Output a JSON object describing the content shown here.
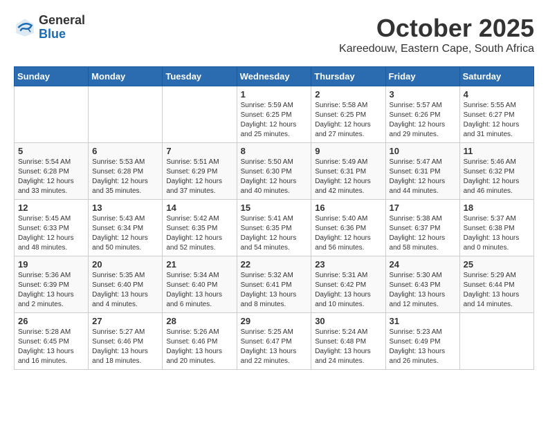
{
  "header": {
    "logo_general": "General",
    "logo_blue": "Blue",
    "title": "October 2025",
    "location": "Kareedouw, Eastern Cape, South Africa"
  },
  "days_of_week": [
    "Sunday",
    "Monday",
    "Tuesday",
    "Wednesday",
    "Thursday",
    "Friday",
    "Saturday"
  ],
  "weeks": [
    [
      {
        "day": "",
        "info": ""
      },
      {
        "day": "",
        "info": ""
      },
      {
        "day": "",
        "info": ""
      },
      {
        "day": "1",
        "info": "Sunrise: 5:59 AM\nSunset: 6:25 PM\nDaylight: 12 hours\nand 25 minutes."
      },
      {
        "day": "2",
        "info": "Sunrise: 5:58 AM\nSunset: 6:25 PM\nDaylight: 12 hours\nand 27 minutes."
      },
      {
        "day": "3",
        "info": "Sunrise: 5:57 AM\nSunset: 6:26 PM\nDaylight: 12 hours\nand 29 minutes."
      },
      {
        "day": "4",
        "info": "Sunrise: 5:55 AM\nSunset: 6:27 PM\nDaylight: 12 hours\nand 31 minutes."
      }
    ],
    [
      {
        "day": "5",
        "info": "Sunrise: 5:54 AM\nSunset: 6:28 PM\nDaylight: 12 hours\nand 33 minutes."
      },
      {
        "day": "6",
        "info": "Sunrise: 5:53 AM\nSunset: 6:28 PM\nDaylight: 12 hours\nand 35 minutes."
      },
      {
        "day": "7",
        "info": "Sunrise: 5:51 AM\nSunset: 6:29 PM\nDaylight: 12 hours\nand 37 minutes."
      },
      {
        "day": "8",
        "info": "Sunrise: 5:50 AM\nSunset: 6:30 PM\nDaylight: 12 hours\nand 40 minutes."
      },
      {
        "day": "9",
        "info": "Sunrise: 5:49 AM\nSunset: 6:31 PM\nDaylight: 12 hours\nand 42 minutes."
      },
      {
        "day": "10",
        "info": "Sunrise: 5:47 AM\nSunset: 6:31 PM\nDaylight: 12 hours\nand 44 minutes."
      },
      {
        "day": "11",
        "info": "Sunrise: 5:46 AM\nSunset: 6:32 PM\nDaylight: 12 hours\nand 46 minutes."
      }
    ],
    [
      {
        "day": "12",
        "info": "Sunrise: 5:45 AM\nSunset: 6:33 PM\nDaylight: 12 hours\nand 48 minutes."
      },
      {
        "day": "13",
        "info": "Sunrise: 5:43 AM\nSunset: 6:34 PM\nDaylight: 12 hours\nand 50 minutes."
      },
      {
        "day": "14",
        "info": "Sunrise: 5:42 AM\nSunset: 6:35 PM\nDaylight: 12 hours\nand 52 minutes."
      },
      {
        "day": "15",
        "info": "Sunrise: 5:41 AM\nSunset: 6:35 PM\nDaylight: 12 hours\nand 54 minutes."
      },
      {
        "day": "16",
        "info": "Sunrise: 5:40 AM\nSunset: 6:36 PM\nDaylight: 12 hours\nand 56 minutes."
      },
      {
        "day": "17",
        "info": "Sunrise: 5:38 AM\nSunset: 6:37 PM\nDaylight: 12 hours\nand 58 minutes."
      },
      {
        "day": "18",
        "info": "Sunrise: 5:37 AM\nSunset: 6:38 PM\nDaylight: 13 hours\nand 0 minutes."
      }
    ],
    [
      {
        "day": "19",
        "info": "Sunrise: 5:36 AM\nSunset: 6:39 PM\nDaylight: 13 hours\nand 2 minutes."
      },
      {
        "day": "20",
        "info": "Sunrise: 5:35 AM\nSunset: 6:40 PM\nDaylight: 13 hours\nand 4 minutes."
      },
      {
        "day": "21",
        "info": "Sunrise: 5:34 AM\nSunset: 6:40 PM\nDaylight: 13 hours\nand 6 minutes."
      },
      {
        "day": "22",
        "info": "Sunrise: 5:32 AM\nSunset: 6:41 PM\nDaylight: 13 hours\nand 8 minutes."
      },
      {
        "day": "23",
        "info": "Sunrise: 5:31 AM\nSunset: 6:42 PM\nDaylight: 13 hours\nand 10 minutes."
      },
      {
        "day": "24",
        "info": "Sunrise: 5:30 AM\nSunset: 6:43 PM\nDaylight: 13 hours\nand 12 minutes."
      },
      {
        "day": "25",
        "info": "Sunrise: 5:29 AM\nSunset: 6:44 PM\nDaylight: 13 hours\nand 14 minutes."
      }
    ],
    [
      {
        "day": "26",
        "info": "Sunrise: 5:28 AM\nSunset: 6:45 PM\nDaylight: 13 hours\nand 16 minutes."
      },
      {
        "day": "27",
        "info": "Sunrise: 5:27 AM\nSunset: 6:46 PM\nDaylight: 13 hours\nand 18 minutes."
      },
      {
        "day": "28",
        "info": "Sunrise: 5:26 AM\nSunset: 6:46 PM\nDaylight: 13 hours\nand 20 minutes."
      },
      {
        "day": "29",
        "info": "Sunrise: 5:25 AM\nSunset: 6:47 PM\nDaylight: 13 hours\nand 22 minutes."
      },
      {
        "day": "30",
        "info": "Sunrise: 5:24 AM\nSunset: 6:48 PM\nDaylight: 13 hours\nand 24 minutes."
      },
      {
        "day": "31",
        "info": "Sunrise: 5:23 AM\nSunset: 6:49 PM\nDaylight: 13 hours\nand 26 minutes."
      },
      {
        "day": "",
        "info": ""
      }
    ]
  ]
}
